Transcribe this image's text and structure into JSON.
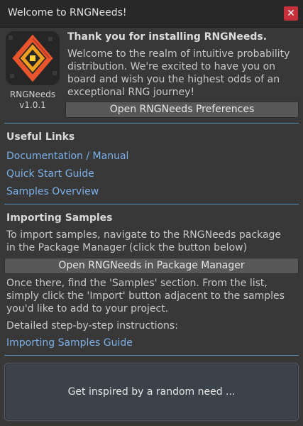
{
  "window": {
    "title": "Welcome to RNGNeeds!",
    "close_glyph": "✕"
  },
  "app": {
    "name": "RNGNeeds",
    "version": "v1.0.1",
    "logo_icon": "rngneeds-logo-icon",
    "accent_color": "#e8552c"
  },
  "intro": {
    "heading": "Thank you for installing RNGNeeds.",
    "welcome_lines": [
      "Welcome to the realm of intuitive probability",
      "distribution. We're excited to have you on",
      "board and wish you the highest odds of an",
      "exceptional RNG journey!"
    ],
    "preferences_button": "Open RNGNeeds Preferences"
  },
  "useful_links": {
    "title": "Useful Links",
    "items": [
      "Documentation / Manual",
      "Quick Start Guide",
      "Samples Overview"
    ]
  },
  "importing": {
    "title": "Importing Samples",
    "instruction_lines": [
      "To import samples, navigate to the RNGNeeds package",
      "in the Package Manager (click the button below)"
    ],
    "package_manager_button": "Open RNGNeeds in Package Manager",
    "after_lines": [
      "Once there, find the 'Samples' section. From the list,",
      "simply click the 'Import' button adjacent to the samples",
      "you'd like to add to your project."
    ],
    "detailed_label": "Detailed step-by-step instructions:",
    "guide_link": "Importing Samples Guide"
  },
  "inspire_button": "Get inspired by a random need ...",
  "colors": {
    "background": "#383838",
    "link": "#7cb0e8",
    "separator": "#5a8fb3",
    "close": "#c5303b"
  }
}
